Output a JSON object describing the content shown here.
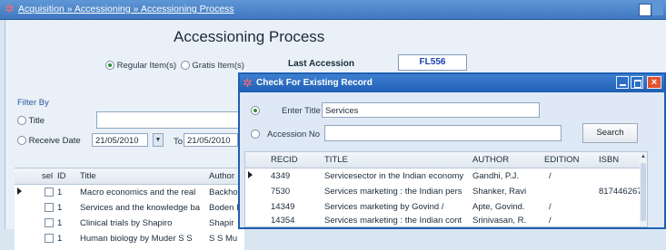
{
  "window": {
    "breadcrumb": "Acquisition » Accessioning » Accessioning Process"
  },
  "page": {
    "title": "Accessioning Process",
    "regular_items_label": "Regular Item(s)",
    "gratis_items_label": "Gratis Item(s)",
    "last_accession_label": "Last Accession",
    "last_accession_value": "FL556"
  },
  "filter": {
    "label": "Filter By",
    "title_label": "Title",
    "receive_date_label": "Receive Date",
    "from_date": "21/05/2010",
    "to_label": "To",
    "to_date": "21/05/2010"
  },
  "main_table": {
    "columns": [
      "sel",
      "ID",
      "Title",
      "Author"
    ],
    "rows": [
      {
        "id": "1",
        "title": "Macro economics and the real",
        "author": "Backho"
      },
      {
        "id": "1",
        "title": "Services and the knowledge ba",
        "author": "Boden I"
      },
      {
        "id": "1",
        "title": "Clinical trials by Shapiro",
        "author": "Shapir"
      },
      {
        "id": "1",
        "title": "Human biology by Muder S S",
        "author": "S S Mu"
      }
    ]
  },
  "dialog": {
    "title": "Check For Existing Record",
    "enter_title_label": "Enter Title",
    "enter_title_value": "Services",
    "accession_no_label": "Accession No",
    "search_label": "Search",
    "columns": [
      "RECID",
      "TITLE",
      "AUTHOR",
      "EDITION",
      "ISBN"
    ],
    "rows": [
      {
        "recid": "4349",
        "title": "Servicesector in the Indian economy",
        "author": "Gandhi, P.J.",
        "edition": "/",
        "isbn": ""
      },
      {
        "recid": "7530",
        "title": "Services marketing : the Indian pers",
        "author": "Shanker, Ravi",
        "edition": "",
        "isbn": "817446267"
      },
      {
        "recid": "14349",
        "title": "Services marketing by Govind /",
        "author": "Apte, Govind.",
        "edition": "/",
        "isbn": ""
      },
      {
        "recid": "14354",
        "title": "Services marketing : the Indian cont",
        "author": "Srinivasan, R.",
        "edition": "/",
        "isbn": ""
      }
    ]
  }
}
